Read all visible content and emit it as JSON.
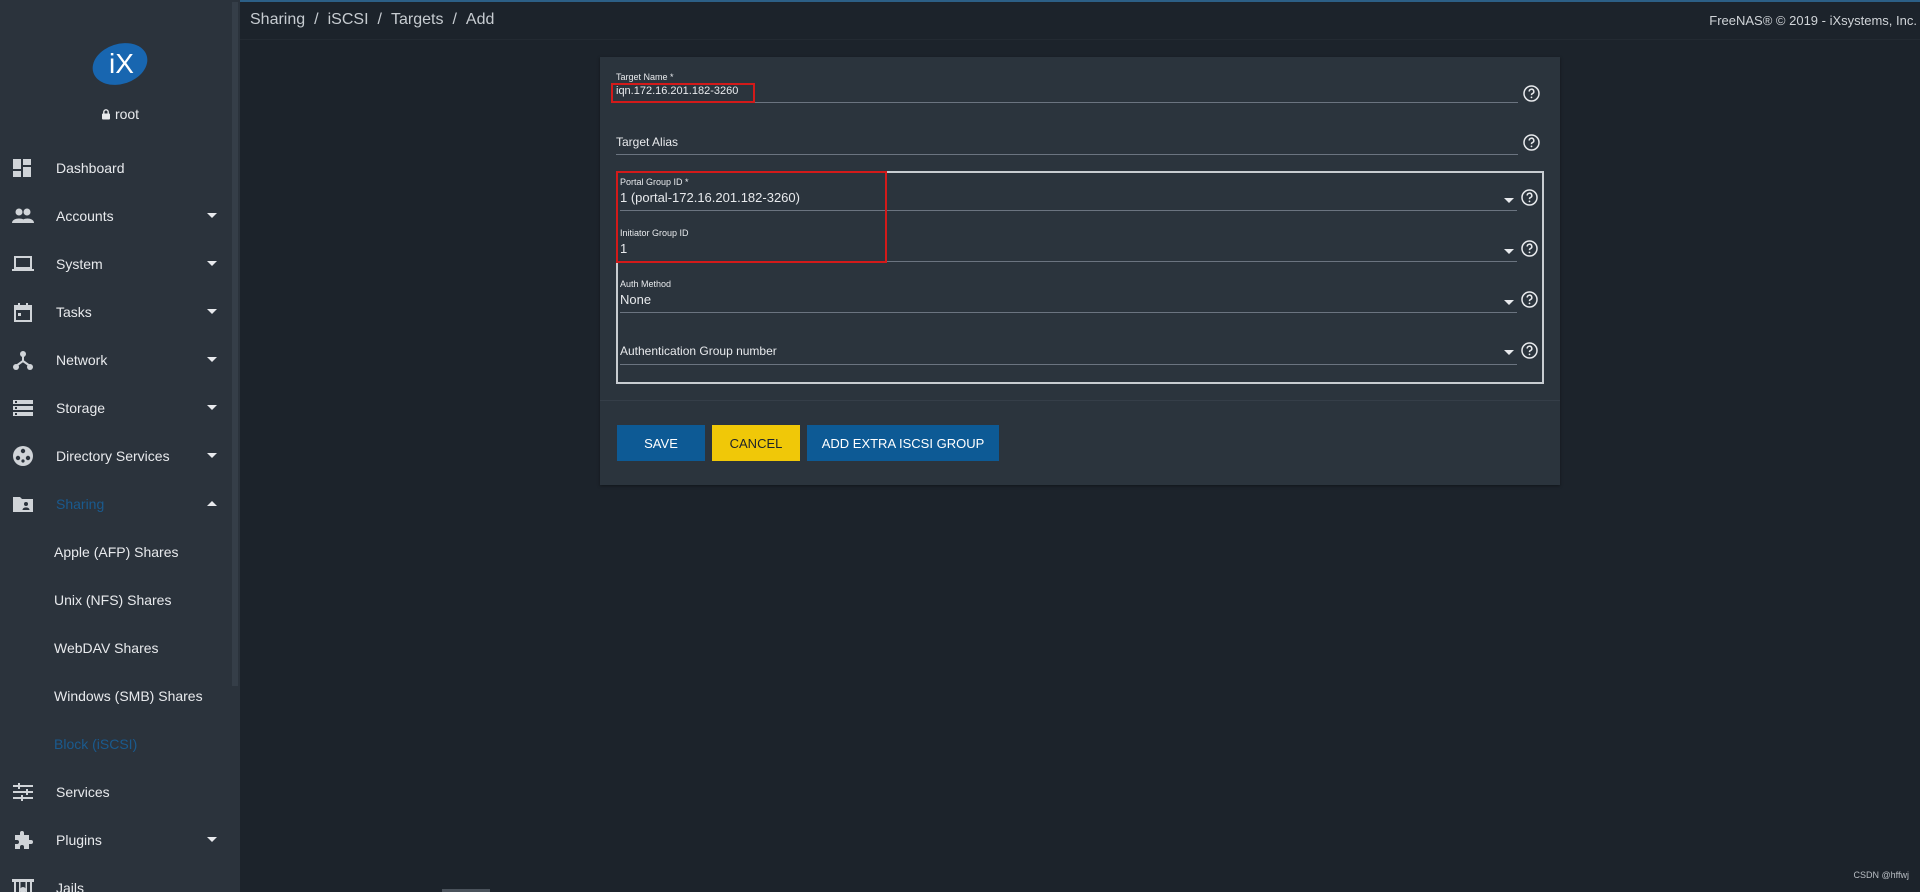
{
  "app": {
    "user": "root",
    "copyright": "FreeNAS® © 2019 - iXsystems, Inc.",
    "watermark": "CSDN @hffwj",
    "accent_color": "#1a5a8e"
  },
  "breadcrumb": [
    "Sharing",
    "iSCSI",
    "Targets",
    "Add"
  ],
  "sidebar": {
    "items": [
      {
        "label": "Dashboard",
        "icon": "dashboard-icon",
        "expandable": false
      },
      {
        "label": "Accounts",
        "icon": "accounts-icon",
        "expandable": true
      },
      {
        "label": "System",
        "icon": "laptop-icon",
        "expandable": true
      },
      {
        "label": "Tasks",
        "icon": "calendar-icon",
        "expandable": true
      },
      {
        "label": "Network",
        "icon": "network-icon",
        "expandable": true
      },
      {
        "label": "Storage",
        "icon": "storage-icon",
        "expandable": true
      },
      {
        "label": "Directory Services",
        "icon": "directory-icon",
        "expandable": true
      },
      {
        "label": "Sharing",
        "icon": "folder-shared-icon",
        "expandable": true,
        "active": true,
        "expanded": true
      }
    ],
    "sharing_sub": [
      {
        "label": "Apple (AFP) Shares"
      },
      {
        "label": "Unix (NFS) Shares"
      },
      {
        "label": "WebDAV Shares"
      },
      {
        "label": "Windows (SMB) Shares"
      },
      {
        "label": "Block (iSCSI)",
        "active": true
      }
    ],
    "items_after": [
      {
        "label": "Services",
        "icon": "tune-icon",
        "expandable": false
      },
      {
        "label": "Plugins",
        "icon": "puzzle-icon",
        "expandable": true
      },
      {
        "label": "Jails",
        "icon": "jail-icon",
        "expandable": false
      }
    ]
  },
  "form": {
    "target_name": {
      "label": "Target Name *",
      "value": "iqn.172.16.201.182-3260"
    },
    "target_alias": {
      "label": "Target Alias",
      "value": ""
    },
    "portal_group": {
      "label": "Portal Group ID *",
      "value": "1 (portal-172.16.201.182-3260)"
    },
    "initiator_group": {
      "label": "Initiator Group ID",
      "value": "1"
    },
    "auth_method": {
      "label": "Auth Method",
      "value": "None"
    },
    "auth_group": {
      "label": "Authentication Group number",
      "value": ""
    },
    "buttons": {
      "save": "SAVE",
      "cancel": "CANCEL",
      "extra": "ADD EXTRA ISCSI GROUP"
    }
  }
}
